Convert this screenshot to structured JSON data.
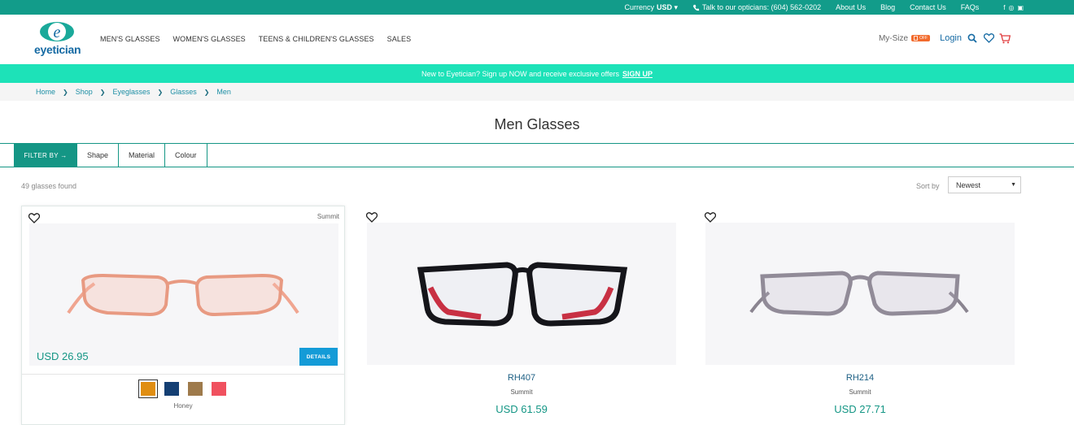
{
  "topbar": {
    "currency_label": "Currency",
    "currency_value": "USD ▾",
    "phone": "Talk to our opticians: (604) 562-0202",
    "links": [
      "About Us",
      "Blog",
      "Contact Us",
      "FAQs"
    ]
  },
  "header": {
    "logo_text": "eyetician",
    "nav": [
      "MEN'S GLASSES",
      "WOMEN'S GLASSES",
      "TEENS & CHILDREN'S GLASSES",
      "SALES"
    ],
    "mysize": "My-Size",
    "mysize_badge": "OFF",
    "login": "Login"
  },
  "promo": {
    "text": "New to Eyetician? Sign up NOW and receive exclusive offers",
    "link": "SIGN UP"
  },
  "breadcrumb": [
    "Home",
    "Shop",
    "Eyeglasses",
    "Glasses",
    "Men"
  ],
  "page_title": "Men Glasses",
  "filter": {
    "button": "FILTER BY →",
    "options": [
      "Shape",
      "Material",
      "Colour"
    ]
  },
  "results": {
    "count": "49 glasses found",
    "sort_label": "Sort by",
    "sort_value": "Newest"
  },
  "products": [
    {
      "brand": "Summit",
      "price": "USD 26.95",
      "details": "DETAILS",
      "swatches": [
        "#e08e12",
        "#143f73",
        "#9e7a4b",
        "#f0515f"
      ],
      "selected_swatch": 0,
      "color_name": "Honey"
    },
    {
      "model": "RH407",
      "brand": "Summit",
      "price": "USD 61.59"
    },
    {
      "model": "RH214",
      "brand": "Summit",
      "price": "USD 27.71"
    }
  ],
  "colors": {
    "brand_teal": "#129c8a",
    "promo_mint": "#1de2b8",
    "link_blue": "#156aa3",
    "details_blue": "#149bd7"
  }
}
